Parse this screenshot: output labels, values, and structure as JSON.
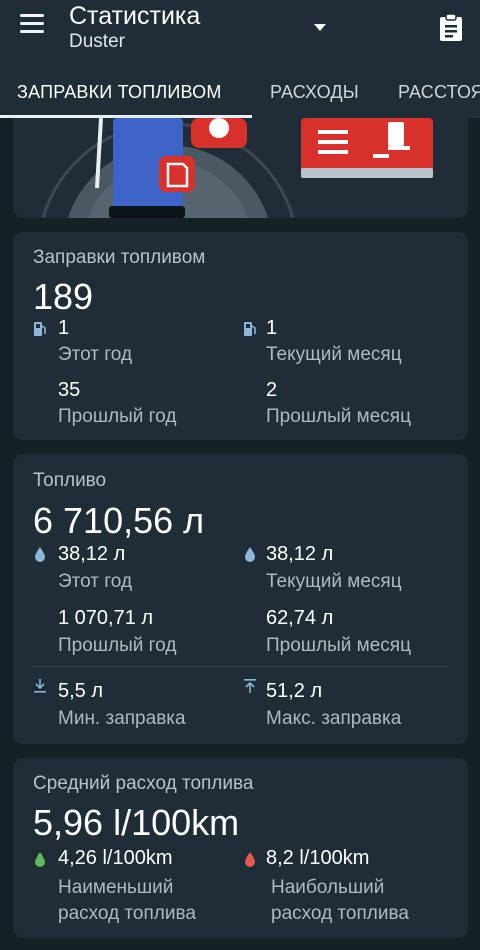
{
  "header": {
    "title": "Статистика",
    "subtitle": "Duster"
  },
  "tabs": [
    {
      "label": "ЗАПРАВКИ ТОПЛИВОМ"
    },
    {
      "label": "РАСХОДЫ"
    },
    {
      "label": "РАССТОЯ"
    }
  ],
  "refuels": {
    "label": "Заправки топливом",
    "total": "189",
    "this_year": {
      "value": "1",
      "label": "Этот год"
    },
    "current_month": {
      "value": "1",
      "label": "Текущий месяц"
    },
    "last_year": {
      "value": "35",
      "label": "Прошлый год"
    },
    "last_month": {
      "value": "2",
      "label": "Прошлый месяц"
    }
  },
  "fuel": {
    "label": "Топливо",
    "total": "6 710,56 л",
    "this_year": {
      "value": "38,12 л",
      "label": "Этот год"
    },
    "current_month": {
      "value": "38,12 л",
      "label": "Текущий месяц"
    },
    "last_year": {
      "value": "1 070,71 л",
      "label": "Прошлый год"
    },
    "last_month": {
      "value": "62,74 л",
      "label": "Прошлый месяц"
    },
    "min": {
      "value": "5,5 л",
      "label": "Мин. заправка"
    },
    "max": {
      "value": "51,2 л",
      "label": "Макс. заправка"
    }
  },
  "consumption": {
    "label": "Средний расход топлива",
    "average": "5,96 l/100km",
    "min": {
      "value": "4,26 l/100km",
      "label_line1": "Наименьший",
      "label_line2": "расход топлива"
    },
    "max": {
      "value": "8,2 l/100km",
      "label_line1": "Наибольший",
      "label_line2": "расход топлива"
    }
  },
  "icons": {
    "menu": "menu-icon",
    "dropdown": "dropdown-triangle-icon",
    "clipboard": "clipboard-icon",
    "fuel_pump": "fuel-pump-icon",
    "drop": "drop-icon",
    "min": "arrow-down-to-line-icon",
    "max": "arrow-up-to-line-icon"
  },
  "colors": {
    "background": "#162027",
    "card": "#1f2d36",
    "drop_blue": "#8fb6d9",
    "drop_green": "#5fb85f",
    "drop_red": "#e45a4f",
    "pump_blue": "#3f64c8",
    "accent_red": "#d8302b"
  }
}
